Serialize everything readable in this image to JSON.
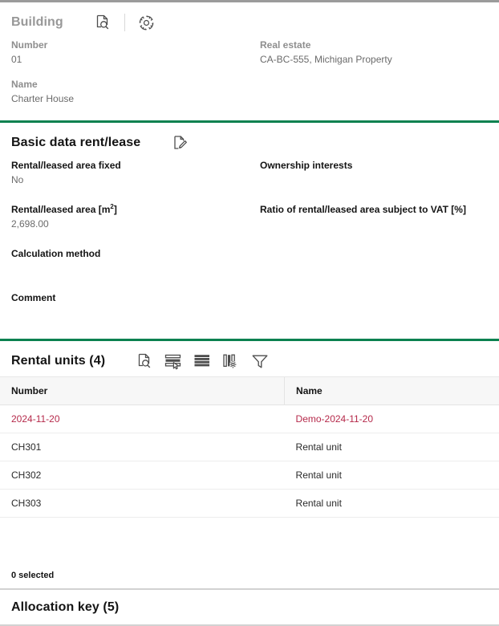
{
  "colors": {
    "accent_green": "#0a8150",
    "top_rule_gray": "#9b9b9b",
    "highlight_red": "#b5294a",
    "muted_text": "#8e8e8e",
    "value_text": "#6b6b6b"
  },
  "building": {
    "title": "Building",
    "tools": [
      {
        "name": "document-search-icon",
        "label": "Display details"
      },
      {
        "name": "gear-icon",
        "label": "Settings"
      }
    ],
    "fields": {
      "number_label": "Number",
      "number_value": "01",
      "real_estate_label": "Real estate",
      "real_estate_value": "CA-BC-555, Michigan Property",
      "name_label": "Name",
      "name_value": "Charter House"
    }
  },
  "basic_data": {
    "title": "Basic data rent/lease",
    "tools": [
      {
        "name": "document-edit-icon",
        "label": "Edit"
      }
    ],
    "fields": {
      "area_fixed_label": "Rental/leased area fixed",
      "area_fixed_value": "No",
      "ownership_label": "Ownership interests",
      "ownership_value": "",
      "area_label_prefix": "Rental/leased area [m",
      "area_label_sup": "2",
      "area_label_suffix": "]",
      "area_value": "2,698.00",
      "vat_ratio_label": "Ratio of rental/leased area subject to VAT [%]",
      "vat_ratio_value": "",
      "calc_method_label": "Calculation method",
      "calc_method_value": "",
      "comment_label": "Comment",
      "comment_value": ""
    }
  },
  "rental_units": {
    "title": "Rental units (4)",
    "tools": [
      {
        "name": "document-search-icon",
        "label": "Display details"
      },
      {
        "name": "select-rows-icon",
        "label": "Select rows"
      },
      {
        "name": "rows-icon",
        "label": "Row layout"
      },
      {
        "name": "column-settings-icon",
        "label": "Column settings"
      },
      {
        "name": "filter-icon",
        "label": "Filter"
      }
    ],
    "columns": [
      "Number",
      "Name"
    ],
    "rows": [
      {
        "number": "2024-11-20",
        "name": "Demo-2024-11-20",
        "highlight": true
      },
      {
        "number": "CH301",
        "name": "Rental unit",
        "highlight": false
      },
      {
        "number": "CH302",
        "name": "Rental unit",
        "highlight": false
      },
      {
        "number": "CH303",
        "name": "Rental unit",
        "highlight": false
      }
    ],
    "selection_status": "0 selected"
  },
  "allocation_key": {
    "title": "Allocation key (5)"
  }
}
